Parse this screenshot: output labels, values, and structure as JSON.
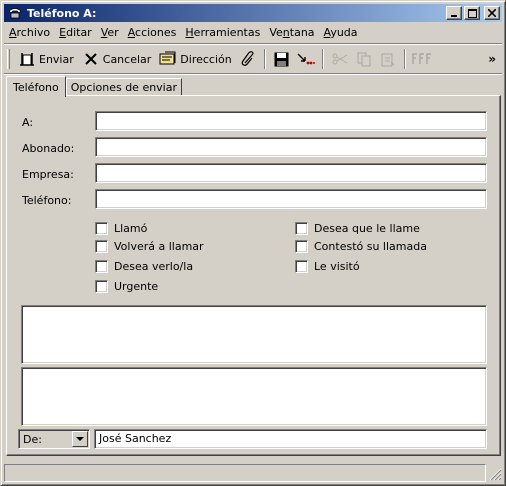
{
  "window": {
    "title": "Teléfono A:"
  },
  "menu": [
    {
      "pre": "",
      "key": "A",
      "post": "rchivo"
    },
    {
      "pre": "",
      "key": "E",
      "post": "ditar"
    },
    {
      "pre": "",
      "key": "V",
      "post": "er"
    },
    {
      "pre": "",
      "key": "A",
      "post": "cciones"
    },
    {
      "pre": "",
      "key": "H",
      "post": "erramientas"
    },
    {
      "pre": "Ve",
      "key": "n",
      "post": "tana"
    },
    {
      "pre": "",
      "key": "A",
      "post": "yuda"
    }
  ],
  "toolbar": {
    "send": "Enviar",
    "cancel": "Cancelar",
    "address": "Dirección",
    "more": "»"
  },
  "tabs": [
    "Teléfono",
    "Opciones de enviar"
  ],
  "form": {
    "to_label": "A:",
    "subscriber_label": "Abonado:",
    "company_label": "Empresa:",
    "phone_label": "Teléfono:",
    "to_value": "",
    "subscriber_value": "",
    "company_value": "",
    "phone_value": ""
  },
  "checks": {
    "called": "Llamó",
    "will_call": "Volverá a llamar",
    "wants_see": "Desea verlo/la",
    "urgent": "Urgente",
    "wants_call": "Desea que le llame",
    "returned": "Contestó su llamada",
    "visited": "Le visitó"
  },
  "from": {
    "label": "De:",
    "value": "José Sanchez"
  }
}
